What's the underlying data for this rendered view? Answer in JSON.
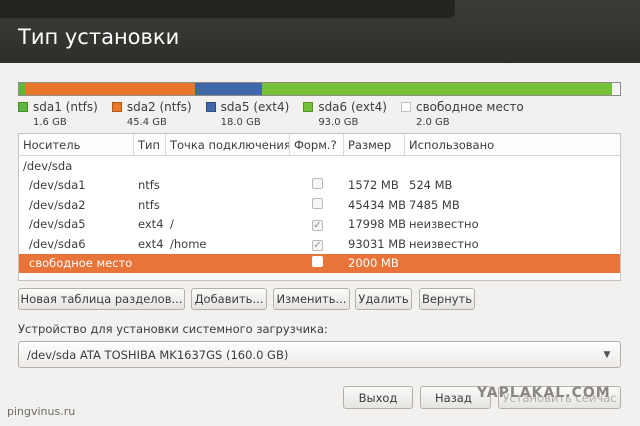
{
  "header": {
    "title": "Тип установки"
  },
  "partition_bar": {
    "segments": [
      {
        "name": "sda1",
        "color": "#5fb83e"
      },
      {
        "name": "sda2",
        "color": "#e9772b"
      },
      {
        "name": "sda5",
        "color": "#3f67a9"
      },
      {
        "name": "sda6",
        "color": "#75c23a"
      },
      {
        "name": "free",
        "color": "#f4f4f4"
      }
    ]
  },
  "legend": [
    {
      "label": "sda1 (ntfs)",
      "size": "1.6 GB",
      "color": "#5fb83e"
    },
    {
      "label": "sda2 (ntfs)",
      "size": "45.4 GB",
      "color": "#e9772b"
    },
    {
      "label": "sda5 (ext4)",
      "size": "18.0 GB",
      "color": "#3f67a9"
    },
    {
      "label": "sda6 (ext4)",
      "size": "93.0 GB",
      "color": "#75c23a"
    },
    {
      "label": "свободное место",
      "size": "2.0 GB",
      "color": "#ffffff"
    }
  ],
  "table": {
    "columns": [
      "Носитель",
      "Тип",
      "Точка подключения",
      "Форм.?",
      "Размер",
      "Использовано"
    ],
    "rows": [
      {
        "device": "/dev/sda",
        "type": "",
        "mount": "",
        "format": "",
        "size": "",
        "used": ""
      },
      {
        "device": "/dev/sda1",
        "type": "ntfs",
        "mount": "",
        "format": "unchecked",
        "size": "1572 MB",
        "used": "524 MB"
      },
      {
        "device": "/dev/sda2",
        "type": "ntfs",
        "mount": "",
        "format": "unchecked",
        "size": "45434 MB",
        "used": "7485 MB"
      },
      {
        "device": "/dev/sda5",
        "type": "ext4",
        "mount": "/",
        "format": "checked",
        "size": "17998 MB",
        "used": "неизвестно"
      },
      {
        "device": "/dev/sda6",
        "type": "ext4",
        "mount": "/home",
        "format": "checked",
        "size": "93031 MB",
        "used": "неизвестно"
      },
      {
        "device": "свободное место",
        "type": "",
        "mount": "",
        "format": "unchecked",
        "size": "2000 MB",
        "used": ""
      }
    ]
  },
  "buttons": {
    "new_table": "Новая таблица разделов...",
    "add": "Добавить...",
    "change": "Изменить...",
    "delete": "Удалить",
    "revert": "Вернуть",
    "quit": "Выход",
    "back": "Назад",
    "install": "Установить сейчас"
  },
  "bootloader": {
    "label": "Устройство для установки системного загрузчика:",
    "value": "/dev/sda    ATA TOSHIBA MK1637GS (160.0 GB)"
  },
  "watermarks": {
    "left": "pingvinus.ru",
    "right": "YAPLAKAL.COM"
  }
}
